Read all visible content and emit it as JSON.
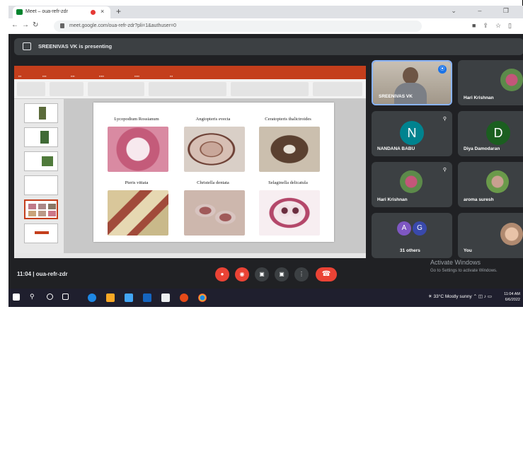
{
  "browser": {
    "tab_title": "Meet – oua-refr-zdr",
    "new_tab": "+",
    "close_tab": "×",
    "url": "meet.google.com/oua-refr-zdr?pli=1&authuser=0",
    "window_controls": "⌄ – ❐"
  },
  "meet": {
    "presenting_banner": "SREENIVAS VK is presenting",
    "meeting_time": "11:04",
    "meeting_code": "oua-refr-zdr",
    "separator": "|"
  },
  "slide": {
    "species": [
      "Lycopodium Rossianum",
      "Angiopteris evecta",
      "Ceratopteris thalictroides",
      "Pteris vittata",
      "Christella dentata",
      "Selaginella delicatula"
    ]
  },
  "participants": [
    {
      "name": "SREENIVAS VK",
      "type": "video"
    },
    {
      "name": "Hari Krishnan",
      "type": "photo"
    },
    {
      "name": "NANDANA BABU",
      "initial": "N",
      "color": "#00838f",
      "type": "avatar"
    },
    {
      "name": "Diya Damodaran",
      "initial": "D",
      "color": "#1b5e20",
      "type": "avatar"
    },
    {
      "name": "Hari Krishnan",
      "type": "photo"
    },
    {
      "name": "aroma suresh",
      "type": "photo"
    },
    {
      "name": "31 others",
      "initials": [
        "A",
        "G"
      ],
      "type": "group"
    },
    {
      "name": "You",
      "type": "photo"
    }
  ],
  "watermark": {
    "line1": "Activate Windows",
    "line2": "Go to Settings to activate Windows."
  },
  "taskbar": {
    "weather": "33°C  Mostly sunny",
    "time": "11:04 AM",
    "date": "6/6/2022"
  },
  "colors": {
    "meet_bg": "#202124",
    "tile_bg": "#3c4043",
    "end_call": "#ea4335",
    "ppt_accent": "#c43e1c"
  }
}
